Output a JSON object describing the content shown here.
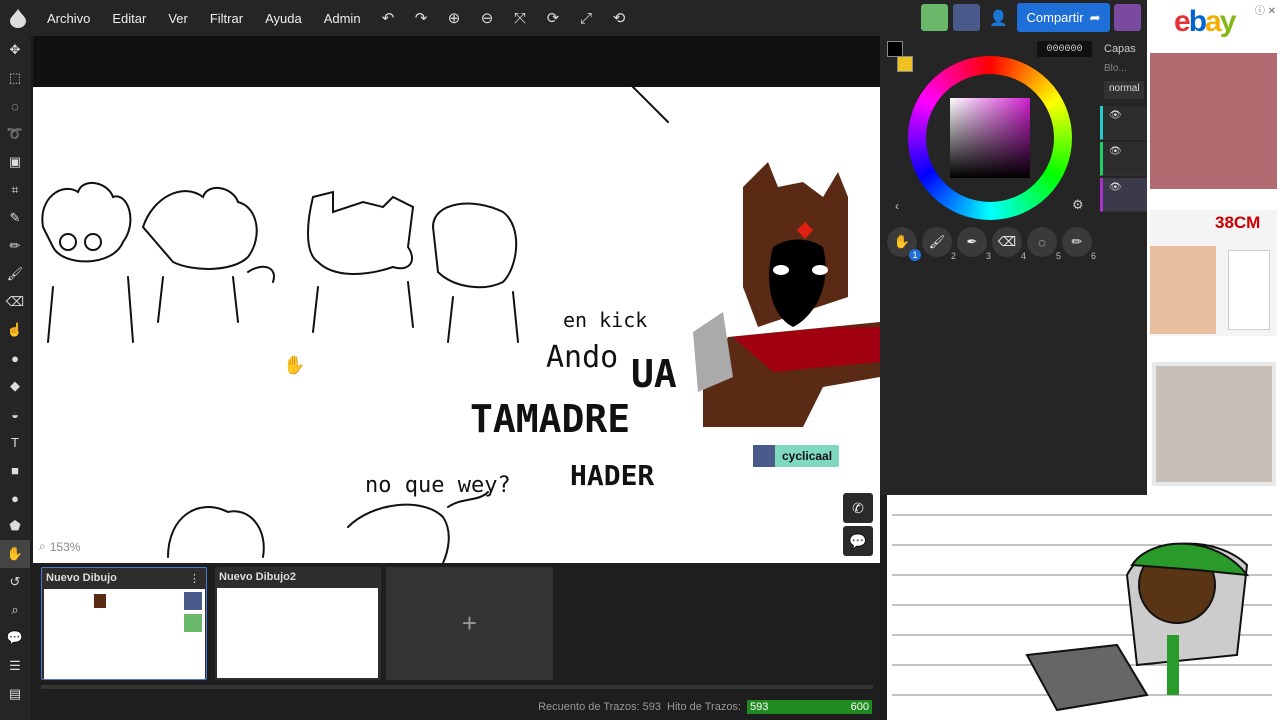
{
  "menu": [
    "Archivo",
    "Editar",
    "Ver",
    "Filtrar",
    "Ayuda",
    "Admin"
  ],
  "share_label": "Compartir",
  "color_hex": "000000",
  "layers": {
    "title": "Capas",
    "blend_short": "Blo...",
    "mode": "normal"
  },
  "zoom": "153%",
  "cursor_user": "cyclicaal",
  "tabs": [
    {
      "label": "Nuevo Dibujo"
    },
    {
      "label": "Nuevo Dibujo2"
    }
  ],
  "add_tab": "+",
  "status": {
    "strokes_label": "Recuento de Trazos: 593",
    "hits_label": "Hito de Trazos:",
    "bar_value": "593",
    "bar_max": "600",
    "progress": 0.988
  },
  "brushes": [
    "1",
    "2",
    "3",
    "4",
    "5",
    "6"
  ],
  "ad": {
    "brand": "ebay",
    "badge": "38CM"
  },
  "canvas_text": {
    "a": "en kick",
    "b": "Ando",
    "c": "UA",
    "d": "TAMADRE",
    "e": "HADER",
    "f": "no que wey?"
  },
  "colors": {
    "accent": "#1f6fd9",
    "progress": "#1f8a1f",
    "primary": "#000000",
    "secondary": "#f0c020"
  }
}
